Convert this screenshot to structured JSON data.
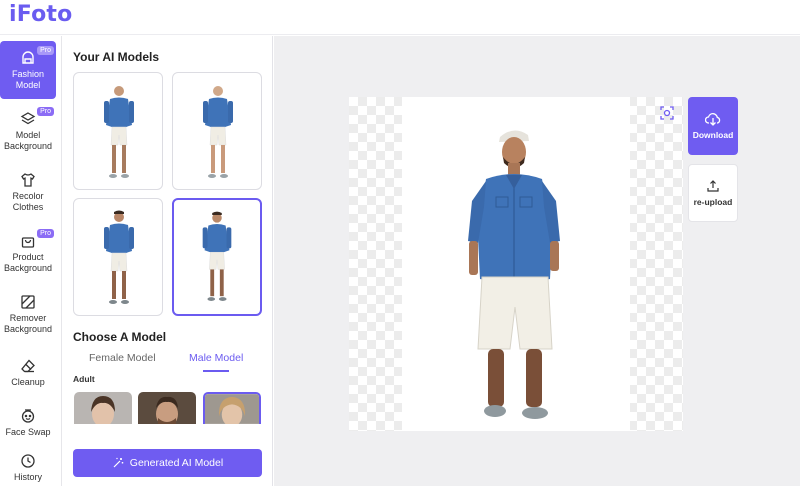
{
  "app": {
    "logo": "iFoto"
  },
  "sidebar": {
    "items": [
      {
        "label": "Fashion Model",
        "icon": "fashion-model-icon",
        "pro": "Pro",
        "active": true
      },
      {
        "label": "Model Background",
        "icon": "layers-icon",
        "pro": "Pro"
      },
      {
        "label": "Recolor Clothes",
        "icon": "shirt-icon"
      },
      {
        "label": "Product Background",
        "icon": "bag-icon",
        "pro": "Pro"
      },
      {
        "label": "Remover Background",
        "icon": "remove-bg-icon"
      },
      {
        "label": "Cleanup",
        "icon": "eraser-icon"
      },
      {
        "label": "Face Swap",
        "icon": "face-swap-icon"
      },
      {
        "label": "History",
        "icon": "clock-icon"
      }
    ]
  },
  "panel": {
    "models_title": "Your AI Models",
    "choose_title": "Choose A Model",
    "tabs": [
      {
        "label": "Female Model"
      },
      {
        "label": "Male Model",
        "active": true
      }
    ],
    "group_label": "Adult",
    "generate_label": "Generated AI Model"
  },
  "canvas": {
    "download_label": "Download",
    "reupload_label": "re-upload"
  },
  "colors": {
    "accent": "#6f5cf1",
    "canvas_bg": "#efeff1",
    "shirt": "#3f73b8",
    "shorts": "#f2efe6"
  }
}
